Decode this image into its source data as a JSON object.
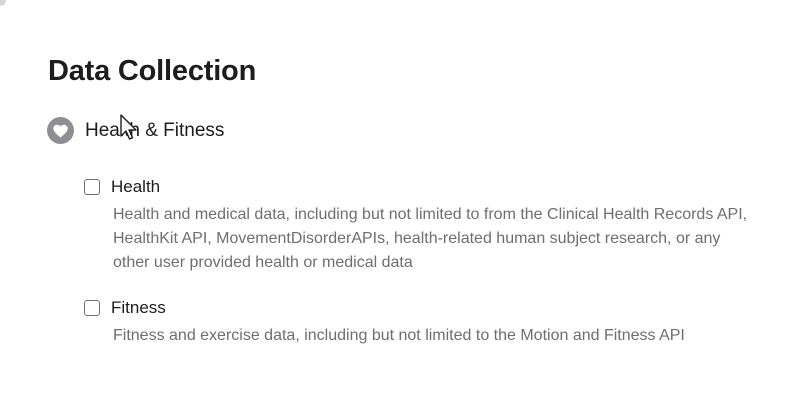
{
  "page": {
    "title": "Data Collection"
  },
  "section": {
    "icon": "heart-icon",
    "label": "Health & Fitness"
  },
  "items": [
    {
      "label": "Health",
      "checked": false,
      "description": "Health and medical data, including but not limited to from the Clinical Health Records API, HealthKit API, MovementDisorderAPIs, health-related human subject research, or any other user provided health or medical data"
    },
    {
      "label": "Fitness",
      "checked": false,
      "description": "Fitness and exercise data, including but not limited to the Motion and Fitness API"
    }
  ],
  "colors": {
    "icon_badge": "#8e8e93",
    "text_primary": "#1d1d1f",
    "text_secondary": "#6e6e73"
  }
}
